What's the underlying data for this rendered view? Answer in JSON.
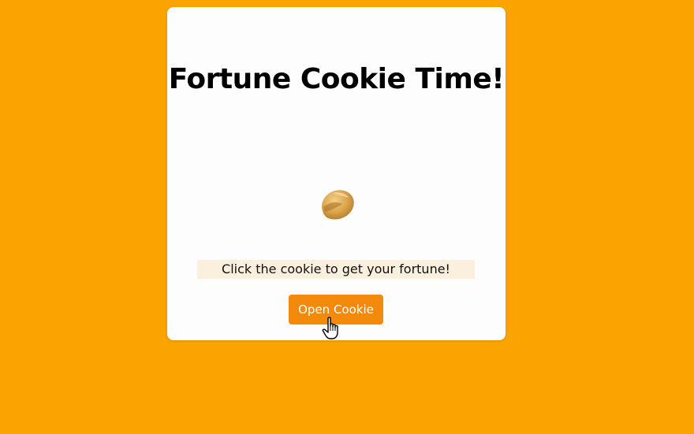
{
  "app": {
    "title": "Fortune Cookie Time!",
    "instruction": "Click the cookie to get your fortune!",
    "button_label": "Open Cookie"
  },
  "icons": {
    "cookie": "fortune-cookie-icon",
    "cursor": "hand-pointer-cursor-icon"
  },
  "colors": {
    "background": "#fba300",
    "card": "#fdfdfd",
    "instruction_bg": "#faf0dd",
    "button": "#f38a0b",
    "button_text": "#ffffff"
  }
}
